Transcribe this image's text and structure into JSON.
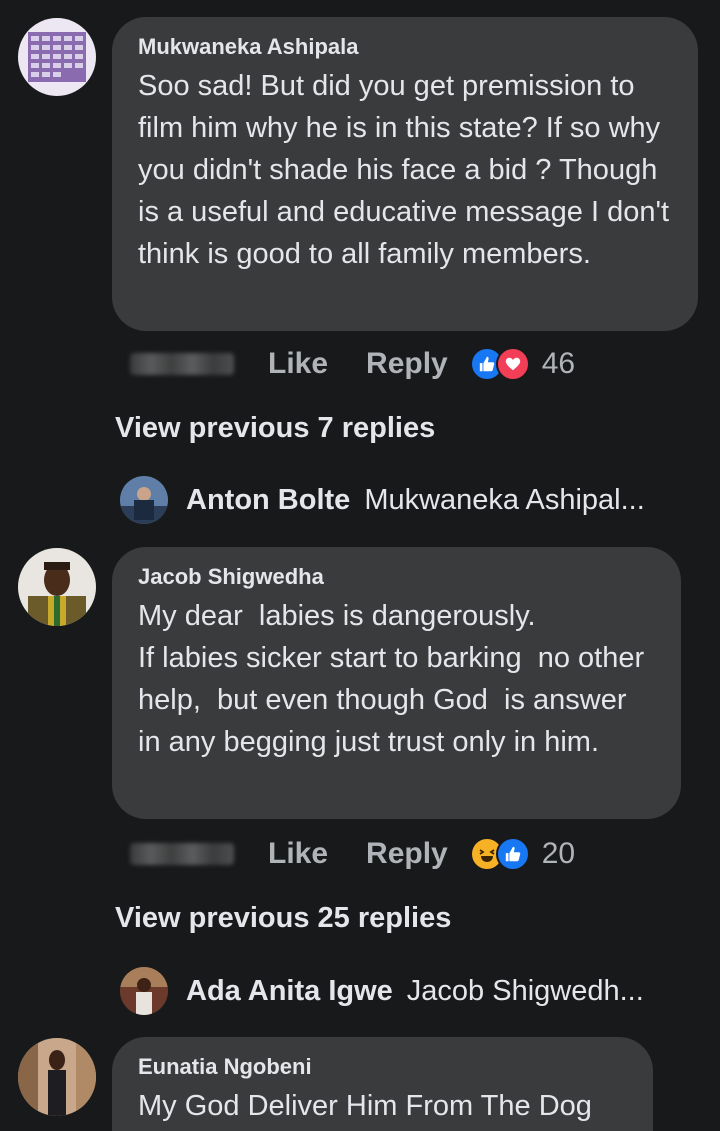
{
  "comments": [
    {
      "author": "Mukwaneka Ashipala",
      "text": "Soo sad! But did you get premission to film him why he is in this state? If so why you didn't shade his face a bid ? Though is a useful and educative message I don't think is good to all family members.",
      "actions": {
        "like": "Like",
        "reply": "Reply"
      },
      "reactions": [
        "like-icon",
        "love-icon"
      ],
      "reaction_count": "46",
      "view_previous": "View previous 7 replies",
      "latest_reply": {
        "name": "Anton Bolte",
        "text": "Mukwaneka Ashipal..."
      }
    },
    {
      "author": "Jacob Shigwedha",
      "text": "My dear  labies is dangerously.\nIf labies sicker start to barking  no other help,  but even though God  is answer in any begging just trust only in him.",
      "actions": {
        "like": "Like",
        "reply": "Reply"
      },
      "reactions": [
        "haha-icon",
        "like-icon"
      ],
      "reaction_count": "20",
      "view_previous": "View previous 25 replies",
      "latest_reply": {
        "name": "Ada Anita Igwe",
        "text": "Jacob Shigwedh..."
      }
    },
    {
      "author": "Eunatia Ngobeni",
      "text": "My God Deliver Him From The Dog"
    }
  ],
  "colors": {
    "background": "#18191a",
    "bubble": "#3a3b3c",
    "primary_text": "#e4e6eb",
    "secondary_text": "#b0b3b8",
    "like_blue": "#1877f2",
    "love_red": "#f33e58",
    "haha_yellow": "#f7b125"
  }
}
